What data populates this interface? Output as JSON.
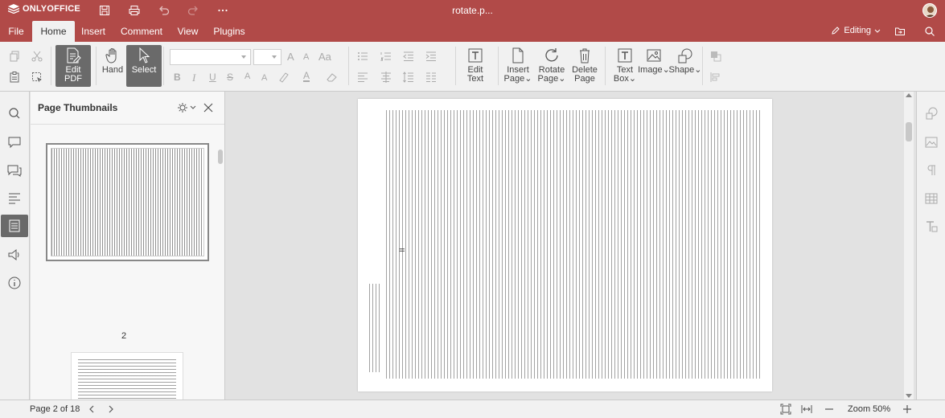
{
  "app": {
    "name": "ONLYOFFICE",
    "document_title": "rotate.p..."
  },
  "menu": {
    "tabs": [
      {
        "label": "File"
      },
      {
        "label": "Home"
      },
      {
        "label": "Insert"
      },
      {
        "label": "Comment"
      },
      {
        "label": "View"
      },
      {
        "label": "Plugins"
      }
    ],
    "active_tab": "Home",
    "editing_label": "Editing"
  },
  "toolbar": {
    "edit_pdf": {
      "line1": "Edit",
      "line2": "PDF"
    },
    "hand": {
      "label": "Hand"
    },
    "select": {
      "label": "Select"
    },
    "edit_text": {
      "line1": "Edit",
      "line2": "Text"
    },
    "insert_page": {
      "line1": "Insert",
      "line2": "Page"
    },
    "rotate_page": {
      "line1": "Rotate",
      "line2": "Page"
    },
    "delete_page": {
      "line1": "Delete",
      "line2": "Page"
    },
    "text_box": {
      "line1": "Text",
      "line2": "Box"
    },
    "image": {
      "label": "Image"
    },
    "shape": {
      "label": "Shape"
    },
    "format_letters": {
      "increase_font": "A",
      "decrease_font": "A",
      "change_case": "Aa",
      "bold": "B",
      "italic": "I",
      "underline": "U",
      "strike": "S",
      "superscript": "A",
      "subscript": "A",
      "font_color": "A"
    }
  },
  "thumbnails": {
    "title": "Page Thumbnails",
    "current_page_number": "2"
  },
  "page_footer_mark": "II",
  "status": {
    "page_info": "Page 2 of 18",
    "zoom": "Zoom 50%"
  },
  "colors": {
    "brand": "#b14a48",
    "active_tool": "#6a6a6a"
  }
}
